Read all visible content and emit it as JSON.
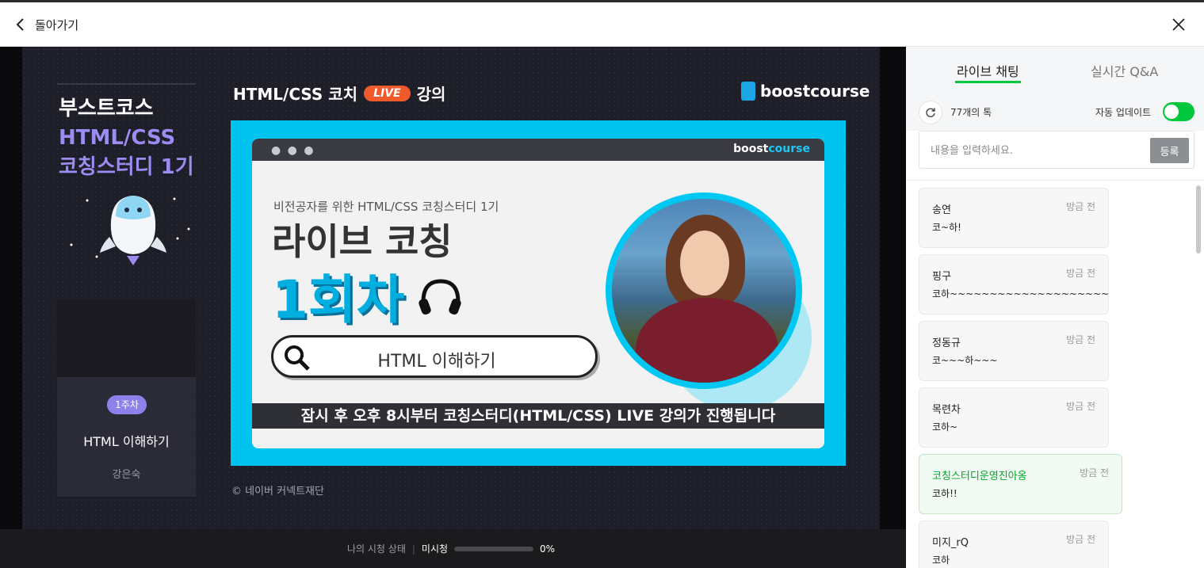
{
  "header": {
    "back_label": "돌아가기"
  },
  "slide": {
    "brand_line1": "부스트코스",
    "brand_line2": "HTML/CSS",
    "brand_line3": "코칭스터디 1기",
    "week_badge": "1주차",
    "week_title": "HTML 이해하기",
    "week_author": "강은숙",
    "head_prefix": "HTML/CSS 코치",
    "head_live": "LIVE",
    "head_suffix": "강의",
    "logo_text": "boostcourse",
    "window_logo_a": "boost",
    "window_logo_b": "course",
    "window_dots": "● ● ●",
    "subtitle": "비전공자를 위한 HTML/CSS 코칭스터디 1기",
    "big_line1": "라이브 코칭",
    "big_line2": "1회차",
    "search_text": "HTML 이해하기",
    "banner": "잠시 후 오후 8시부터 코칭스터디(HTML/CSS) LIVE 강의가 진행됩니다",
    "copyright": "© 네이버 커넥트재단"
  },
  "status": {
    "label": "나의 시청 상태",
    "separator": "|",
    "value": "미시청",
    "progress_percent": 0,
    "percent_text": "0%"
  },
  "chat": {
    "tabs": [
      {
        "label": "라이브 채팅",
        "active": true
      },
      {
        "label": "실시간 Q&A",
        "active": false
      }
    ],
    "talk_count": "77개의 톡",
    "auto_update_label": "자동 업데이트",
    "auto_update_on": true,
    "input_placeholder": "내용을 입력하세요.",
    "submit_label": "등록",
    "messages": [
      {
        "name": "송연",
        "time": "방금 전",
        "text": "코~하!",
        "staff": false
      },
      {
        "name": "핑구",
        "time": "방금 전",
        "text": "코하~~~~~~~~~~~~~~~~~~~~",
        "staff": false
      },
      {
        "name": "정동규",
        "time": "방금 전",
        "text": "코~~~하~~~",
        "staff": false
      },
      {
        "name": "목련차",
        "time": "방금 전",
        "text": "코하~",
        "staff": false
      },
      {
        "name": "코칭스터디운영진아옹",
        "time": "방금 전",
        "text": "코하!!",
        "staff": true
      },
      {
        "name": "미지_rQ",
        "time": "방금 전",
        "text": "코하",
        "staff": false
      }
    ]
  },
  "colors": {
    "accent_green": "#00c73c",
    "live_orange": "#f05a2a",
    "frame_cyan": "#00c3ef",
    "brand_purple": "#9b8cf2"
  }
}
